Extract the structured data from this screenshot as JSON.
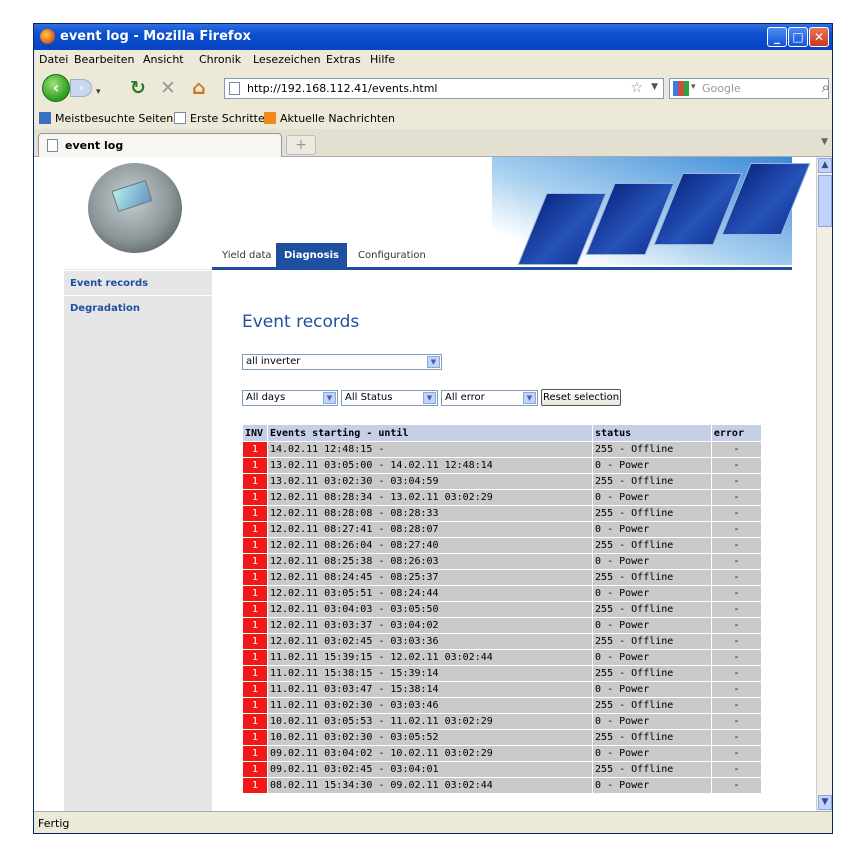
{
  "window": {
    "title": "event log - Mozilla Firefox"
  },
  "menu": [
    "Datei",
    "Bearbeiten",
    "Ansicht",
    "Chronik",
    "Lesezeichen",
    "Extras",
    "Hilfe"
  ],
  "address": {
    "url": "http://192.168.112.41/events.html"
  },
  "search": {
    "placeholder": "Google"
  },
  "bookmarks": [
    "Meistbesuchte Seiten",
    "Erste Schritte",
    "Aktuelle Nachrichten"
  ],
  "tab": {
    "title": "event log",
    "new": "+"
  },
  "status": "Fertig",
  "nav": {
    "yield": "Yield data",
    "diagnosis": "Diagnosis",
    "config": "Configuration"
  },
  "sidebar": [
    "Event records",
    "Degradation"
  ],
  "page": {
    "title": "Event records"
  },
  "filters": {
    "inverter": "all inverter",
    "days": "All days",
    "status": "All Status",
    "error": "All error",
    "reset": "Reset selection"
  },
  "table": {
    "headers": [
      "INV",
      "Events starting - until",
      "status",
      "error"
    ],
    "rows": [
      [
        "1",
        "14.02.11 12:48:15 -",
        "255 - Offline",
        "-"
      ],
      [
        "1",
        "13.02.11 03:05:00 - 14.02.11 12:48:14",
        "0 - Power",
        "-"
      ],
      [
        "1",
        "13.02.11 03:02:30 - 03:04:59",
        "255 - Offline",
        "-"
      ],
      [
        "1",
        "12.02.11 08:28:34 - 13.02.11 03:02:29",
        "0 - Power",
        "-"
      ],
      [
        "1",
        "12.02.11 08:28:08 - 08:28:33",
        "255 - Offline",
        "-"
      ],
      [
        "1",
        "12.02.11 08:27:41 - 08:28:07",
        "0 - Power",
        "-"
      ],
      [
        "1",
        "12.02.11 08:26:04 - 08:27:40",
        "255 - Offline",
        "-"
      ],
      [
        "1",
        "12.02.11 08:25:38 - 08:26:03",
        "0 - Power",
        "-"
      ],
      [
        "1",
        "12.02.11 08:24:45 - 08:25:37",
        "255 - Offline",
        "-"
      ],
      [
        "1",
        "12.02.11 03:05:51 - 08:24:44",
        "0 - Power",
        "-"
      ],
      [
        "1",
        "12.02.11 03:04:03 - 03:05:50",
        "255 - Offline",
        "-"
      ],
      [
        "1",
        "12.02.11 03:03:37 - 03:04:02",
        "0 - Power",
        "-"
      ],
      [
        "1",
        "12.02.11 03:02:45 - 03:03:36",
        "255 - Offline",
        "-"
      ],
      [
        "1",
        "11.02.11 15:39:15 - 12.02.11 03:02:44",
        "0 - Power",
        "-"
      ],
      [
        "1",
        "11.02.11 15:38:15 - 15:39:14",
        "255 - Offline",
        "-"
      ],
      [
        "1",
        "11.02.11 03:03:47 - 15:38:14",
        "0 - Power",
        "-"
      ],
      [
        "1",
        "11.02.11 03:02:30 - 03:03:46",
        "255 - Offline",
        "-"
      ],
      [
        "1",
        "10.02.11 03:05:53 - 11.02.11 03:02:29",
        "0 - Power",
        "-"
      ],
      [
        "1",
        "10.02.11 03:02:30 - 03:05:52",
        "255 - Offline",
        "-"
      ],
      [
        "1",
        "09.02.11 03:04:02 - 10.02.11 03:02:29",
        "0 - Power",
        "-"
      ],
      [
        "1",
        "09.02.11 03:02:45 - 03:04:01",
        "255 - Offline",
        "-"
      ],
      [
        "1",
        "08.02.11 15:34:30 - 09.02.11 03:02:44",
        "0 - Power",
        "-"
      ]
    ]
  },
  "colors": {
    "accent": "#1f4f9f",
    "inv_cell": "#f01818",
    "row_bg": "#c9c9c9",
    "header_bg": "#c5cfe8"
  }
}
